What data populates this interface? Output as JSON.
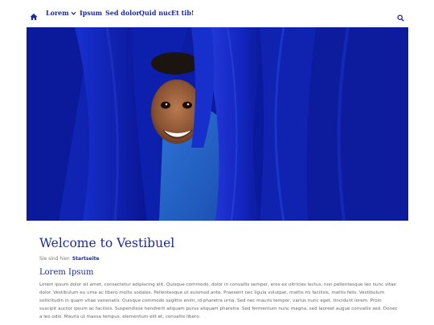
{
  "nav": {
    "items": [
      {
        "label": "Lorem",
        "has_dropdown": true
      },
      {
        "label": "Ipsum"
      },
      {
        "label": "Sed dolor"
      },
      {
        "label": "Quid nuc"
      },
      {
        "label": "Et tib!"
      }
    ],
    "home_icon": "home-icon",
    "search_icon": "search-icon",
    "accent_color": "#1a2a9e"
  },
  "hero": {
    "description_icon": "hero-image",
    "dominant_color": "#0d1fa5"
  },
  "main": {
    "title": "Welcome to Vestibuel",
    "breadcrumb_prefix": "Sie sind hier:",
    "breadcrumb_link": "Startseite",
    "section_heading": "Lorem Ipsum",
    "body": "Lorem ipsum dolor sit amet, consectetur adipiscing elit. Quisque commodo, dolor in convallis semper, eros ex ultricies lectus, non pellentesque leo nunc vitae dolor. Vestibulum eu urna ac libero mollis sodales. Pellentesque ut euismod ante. Praesent nec ligula volutpat, mattis mi facilisis, mattis felis. Vestibulum sollicitudin in quam vitae venenatis. Quisque commodo sagittis enim, id pharetra urna. Sed nec mauris tempor, varius nunc eget, tincidunt lorem. Proin suscipit auctor ipsum ac facilisis. Suspendisse hendrerit aliquam purus aliquam pharetra. Sed fermentum nunc magna, sed laoreet augue convallis sed. Donec a leo odio. Mauris ut massa tempus, elementum elit et, convallis libero."
  }
}
